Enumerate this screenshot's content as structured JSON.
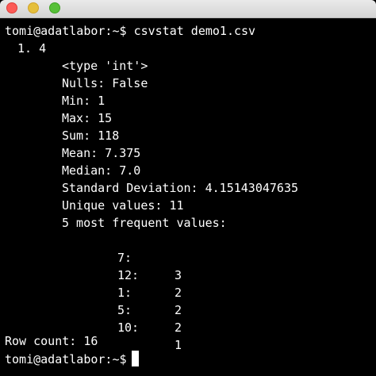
{
  "window": {
    "buttons": [
      "close",
      "minimize",
      "maximize"
    ],
    "colors": {
      "close": "#fc5b57",
      "minimize": "#e5bf3c",
      "maximize": "#57c038",
      "background": "#000000",
      "text": "#ffffff"
    }
  },
  "terminal": {
    "prompt": "tomi@adatlabor:~$",
    "command": "csvstat demo1.csv",
    "column_header": "1. 4",
    "type_line": "<type 'int'>",
    "nulls": "Nulls: False",
    "min": "Min: 1",
    "max": "Max: 15",
    "sum": "Sum: 118",
    "mean": "Mean: 7.375",
    "median": "Median: 7.0",
    "std": "Standard Deviation: 4.15143047635",
    "unique": "Unique values: 11",
    "freq_header": "5 most frequent values:",
    "frequent_values": [
      {
        "value": "7:",
        "count": "3"
      },
      {
        "value": "12:",
        "count": "2"
      },
      {
        "value": "1:",
        "count": "2"
      },
      {
        "value": "5:",
        "count": "2"
      },
      {
        "value": "10:",
        "count": "1"
      }
    ],
    "row_count": "Row count: 16",
    "final_prompt": "tomi@adatlabor:~$"
  }
}
